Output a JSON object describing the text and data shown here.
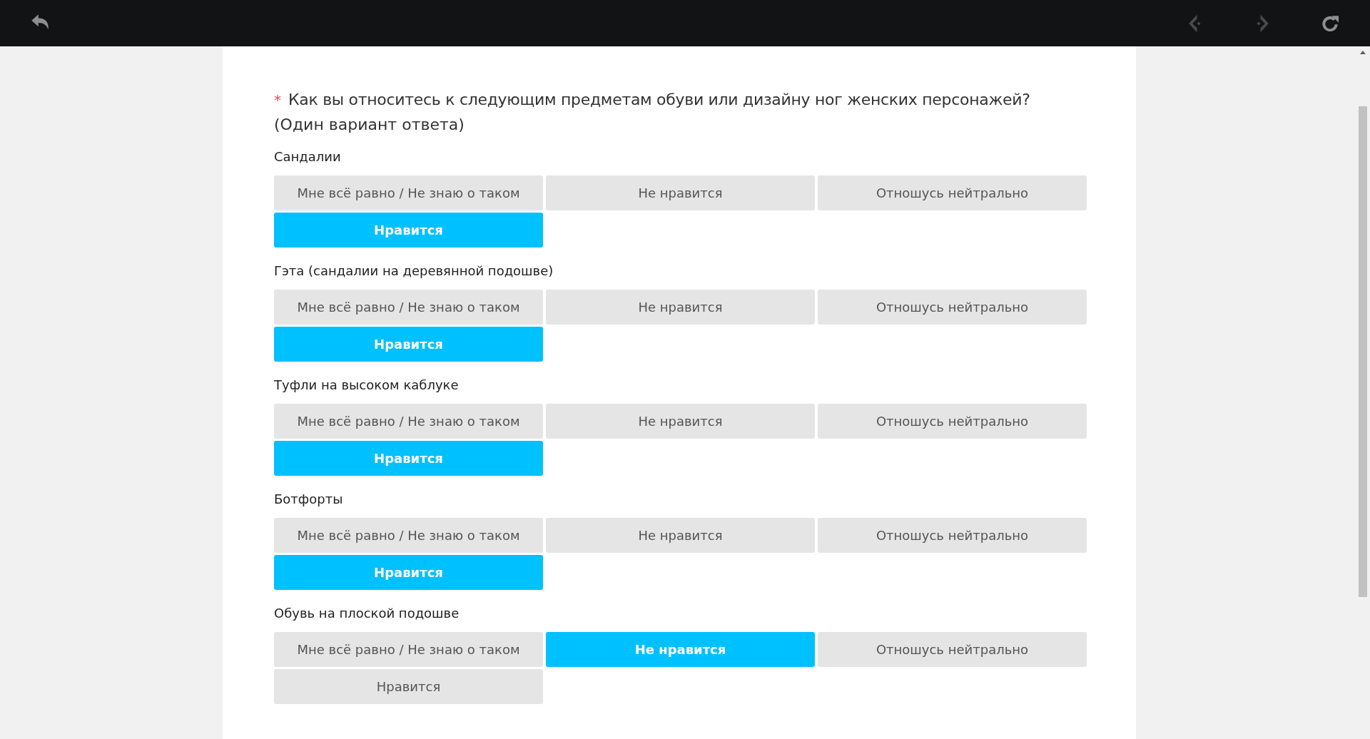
{
  "question": {
    "required_mark": "*",
    "title": "Как вы относитесь к следующим предметам обуви или дизайну ног женских персонажей?",
    "subtitle": "(Один вариант ответа)"
  },
  "items": [
    {
      "label": "Сандалии",
      "options": [
        {
          "label": "Мне всё равно / Не знаю о таком",
          "selected": false
        },
        {
          "label": "Не нравится",
          "selected": false
        },
        {
          "label": "Отношусь нейтрально",
          "selected": false
        },
        {
          "label": "Нравится",
          "selected": true
        }
      ]
    },
    {
      "label": "Гэта (сандалии на деревянной подошве)",
      "options": [
        {
          "label": "Мне всё равно / Не знаю о таком",
          "selected": false
        },
        {
          "label": "Не нравится",
          "selected": false
        },
        {
          "label": "Отношусь нейтрально",
          "selected": false
        },
        {
          "label": "Нравится",
          "selected": true
        }
      ]
    },
    {
      "label": "Туфли на высоком каблуке",
      "options": [
        {
          "label": "Мне всё равно / Не знаю о таком",
          "selected": false
        },
        {
          "label": "Не нравится",
          "selected": false
        },
        {
          "label": "Отношусь нейтрально",
          "selected": false
        },
        {
          "label": "Нравится",
          "selected": true
        }
      ]
    },
    {
      "label": "Ботфорты",
      "options": [
        {
          "label": "Мне всё равно / Не знаю о таком",
          "selected": false
        },
        {
          "label": "Не нравится",
          "selected": false
        },
        {
          "label": "Отношусь нейтрально",
          "selected": false
        },
        {
          "label": "Нравится",
          "selected": true
        }
      ]
    },
    {
      "label": "Обувь на плоской подошве",
      "options": [
        {
          "label": "Мне всё равно / Не знаю о таком",
          "selected": false
        },
        {
          "label": "Не нравится",
          "selected": true
        },
        {
          "label": "Отношусь нейтрально",
          "selected": false
        },
        {
          "label": "Нравится",
          "selected": false
        }
      ]
    }
  ]
}
